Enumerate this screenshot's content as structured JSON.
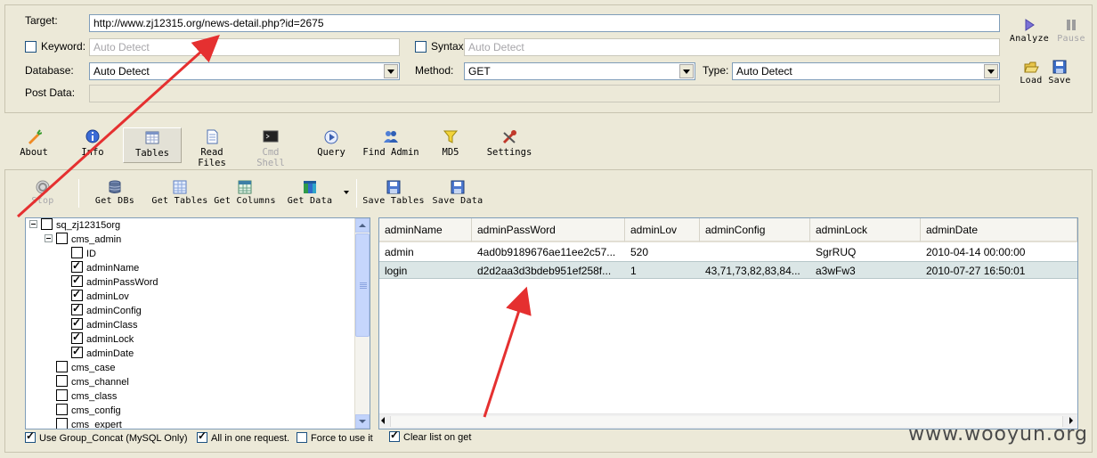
{
  "form": {
    "target_label": "Target:",
    "target_value": "http://www.zj12315.org/news-detail.php?id=2675",
    "keyword_label": "Keyword:",
    "keyword_value": "Auto Detect",
    "syntax_label": "Syntax:",
    "syntax_value": "Auto Detect",
    "database_label": "Database:",
    "database_value": "Auto Detect",
    "method_label": "Method:",
    "method_value": "GET",
    "type_label": "Type:",
    "type_value": "Auto Detect",
    "postdata_label": "Post Data:"
  },
  "actions": {
    "analyze": "Analyze",
    "pause": "Pause",
    "load": "Load",
    "save": "Save"
  },
  "modules": [
    "About",
    "Info",
    "Tables",
    "Read Files",
    "Cmd Shell",
    "Query",
    "Find Admin",
    "MD5",
    "Settings"
  ],
  "toolbar": {
    "stop": "Stop",
    "get_dbs": "Get DBs",
    "get_tables": "Get Tables",
    "get_columns": "Get Columns",
    "get_data": "Get Data",
    "save_tables": "Save Tables",
    "save_data": "Save Data"
  },
  "tree": [
    {
      "label": "sq_zj12315org",
      "level": 0,
      "checked": false,
      "expander": true
    },
    {
      "label": "cms_admin",
      "level": 1,
      "checked": false,
      "expander": true
    },
    {
      "label": "ID",
      "level": 2,
      "checked": false
    },
    {
      "label": "adminName",
      "level": 2,
      "checked": true
    },
    {
      "label": "adminPassWord",
      "level": 2,
      "checked": true
    },
    {
      "label": "adminLov",
      "level": 2,
      "checked": true
    },
    {
      "label": "adminConfig",
      "level": 2,
      "checked": true
    },
    {
      "label": "adminClass",
      "level": 2,
      "checked": true
    },
    {
      "label": "adminLock",
      "level": 2,
      "checked": true
    },
    {
      "label": "adminDate",
      "level": 2,
      "checked": true
    },
    {
      "label": "cms_case",
      "level": 1,
      "checked": false
    },
    {
      "label": "cms_channel",
      "level": 1,
      "checked": false
    },
    {
      "label": "cms_class",
      "level": 1,
      "checked": false
    },
    {
      "label": "cms_config",
      "level": 1,
      "checked": false
    },
    {
      "label": "cms_expert",
      "level": 1,
      "checked": false
    }
  ],
  "grid": {
    "columns": [
      "adminName",
      "adminPassWord",
      "adminLov",
      "adminConfig",
      "adminLock",
      "adminDate"
    ],
    "rows": [
      [
        "admin",
        "4ad0b9189676ae11ee2c57...",
        "520",
        "",
        "SgrRUQ",
        "2010-04-14 00:00:00"
      ],
      [
        "login",
        "d2d2aa3d3bdeb951ef258f...",
        "1",
        "43,71,73,82,83,84...",
        "a3wFw3",
        "2010-07-27 16:50:01"
      ]
    ]
  },
  "options": {
    "group_concat": "Use Group_Concat (MySQL Only)",
    "all_in_one": "All in one request.",
    "force": "Force to use it",
    "clear_list": "Clear list on get"
  },
  "watermark": "www.wooyun.org"
}
